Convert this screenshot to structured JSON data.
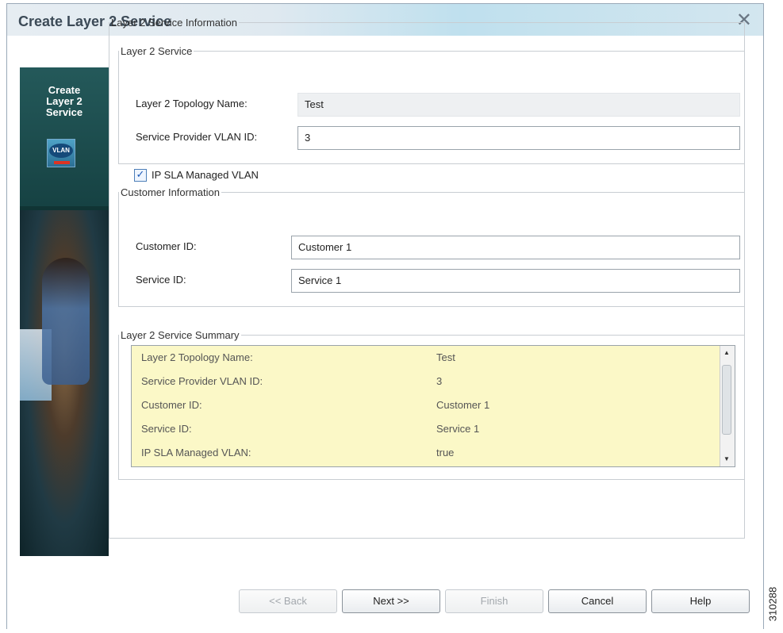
{
  "window": {
    "title": "Create Layer 2 Service"
  },
  "wizard_banner": {
    "title_lines": [
      "Create",
      "Layer 2",
      "Service"
    ],
    "icon_label": "VLAN"
  },
  "info_group": {
    "legend": "Layer 2 Service Information"
  },
  "service_group": {
    "legend": "Layer 2 Service",
    "topology_label": "Layer 2 Topology Name:",
    "topology_value": "Test",
    "vlan_label": "Service Provider VLAN ID:",
    "vlan_value": "3",
    "ipsla_label": "IP SLA Managed VLAN",
    "ipsla_checked": true
  },
  "customer_group": {
    "legend": "Customer Information",
    "customer_label": "Customer ID:",
    "customer_value": "Customer 1",
    "service_label": "Service ID:",
    "service_value": "Service 1"
  },
  "summary_group": {
    "legend": "Layer 2 Service Summary",
    "rows": [
      {
        "key": "Layer 2 Topology Name:",
        "value": "Test"
      },
      {
        "key": "Service Provider VLAN ID:",
        "value": "3"
      },
      {
        "key": "Customer ID:",
        "value": "Customer 1"
      },
      {
        "key": "Service ID:",
        "value": "Service 1"
      },
      {
        "key": "IP SLA Managed VLAN:",
        "value": "true"
      }
    ]
  },
  "buttons": {
    "back": "<< Back",
    "next": "Next >>",
    "finish": "Finish",
    "cancel": "Cancel",
    "help": "Help"
  },
  "figure_id": "310288",
  "colors": {
    "summary_bg": "#fbf8c7",
    "banner_bg": "#0f3333"
  }
}
